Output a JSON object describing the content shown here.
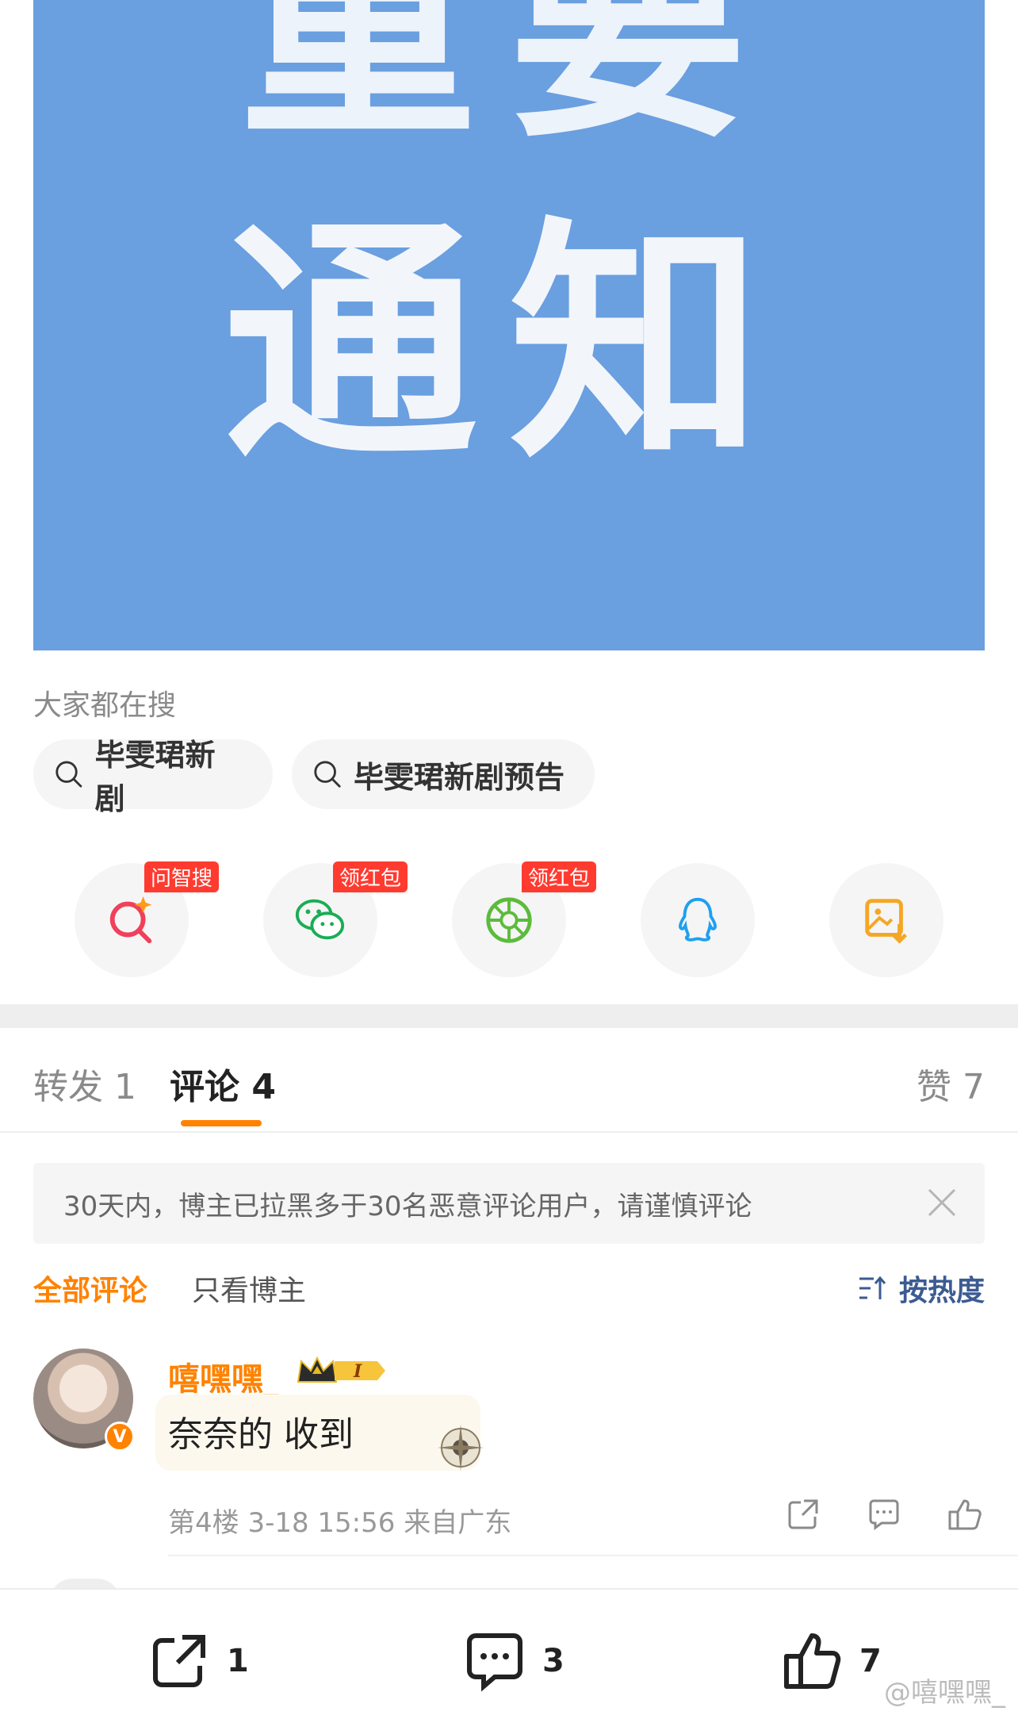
{
  "banner": {
    "line1": "重要",
    "line2": "通知"
  },
  "search": {
    "title": "大家都在搜",
    "chips": [
      "毕雯珺新剧",
      "毕雯珺新剧预告"
    ]
  },
  "share": {
    "items": [
      {
        "icon": "ai-search-icon",
        "badge": "问智搜"
      },
      {
        "icon": "wechat-icon",
        "badge": "领红包"
      },
      {
        "icon": "moments-icon",
        "badge": "领红包"
      },
      {
        "icon": "qq-icon",
        "badge": ""
      },
      {
        "icon": "save-image-icon",
        "badge": ""
      }
    ]
  },
  "tabs": {
    "repost": "转发 1",
    "comments": "评论 4",
    "likes": "赞 7"
  },
  "notice": {
    "text": "30天内，博主已拉黑多于30名恶意评论用户，请谨慎评论"
  },
  "filters": {
    "all": "全部评论",
    "author": "只看博主",
    "sort": "按热度"
  },
  "comment": {
    "user": "嘻嘿嘿_",
    "level": "I",
    "text": "奈奈的 收到",
    "meta": "第4楼  3-18 15:56  来自广东",
    "verified": "V"
  },
  "bottom": {
    "repost_count": "1",
    "comment_count": "3",
    "like_count": "7"
  },
  "watermark": "@嘻嘿嘿_",
  "colors": {
    "accent": "#ff8200",
    "banner": "#6a9fe0",
    "badge": "#ff3b30",
    "sort": "#3b5b92"
  }
}
